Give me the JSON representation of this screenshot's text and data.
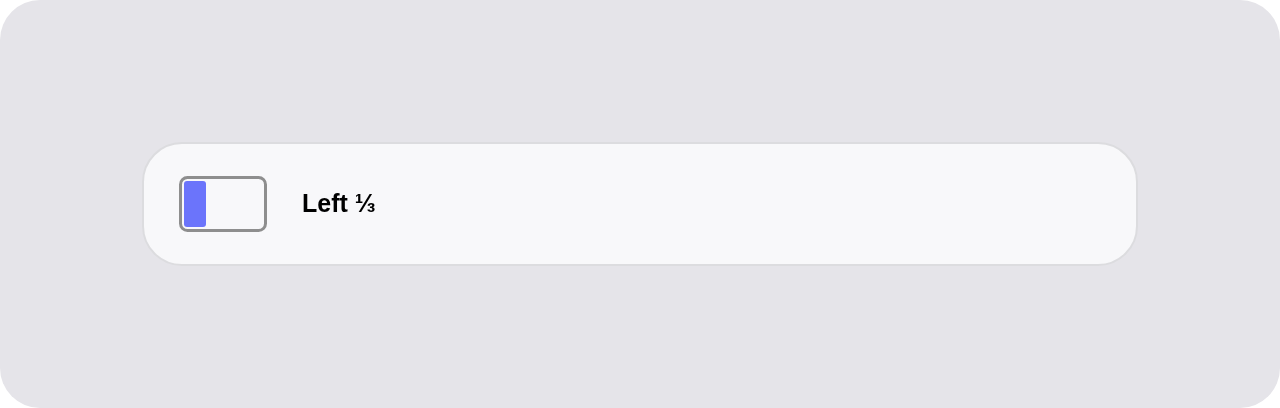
{
  "option": {
    "label": "Left ⅓"
  }
}
